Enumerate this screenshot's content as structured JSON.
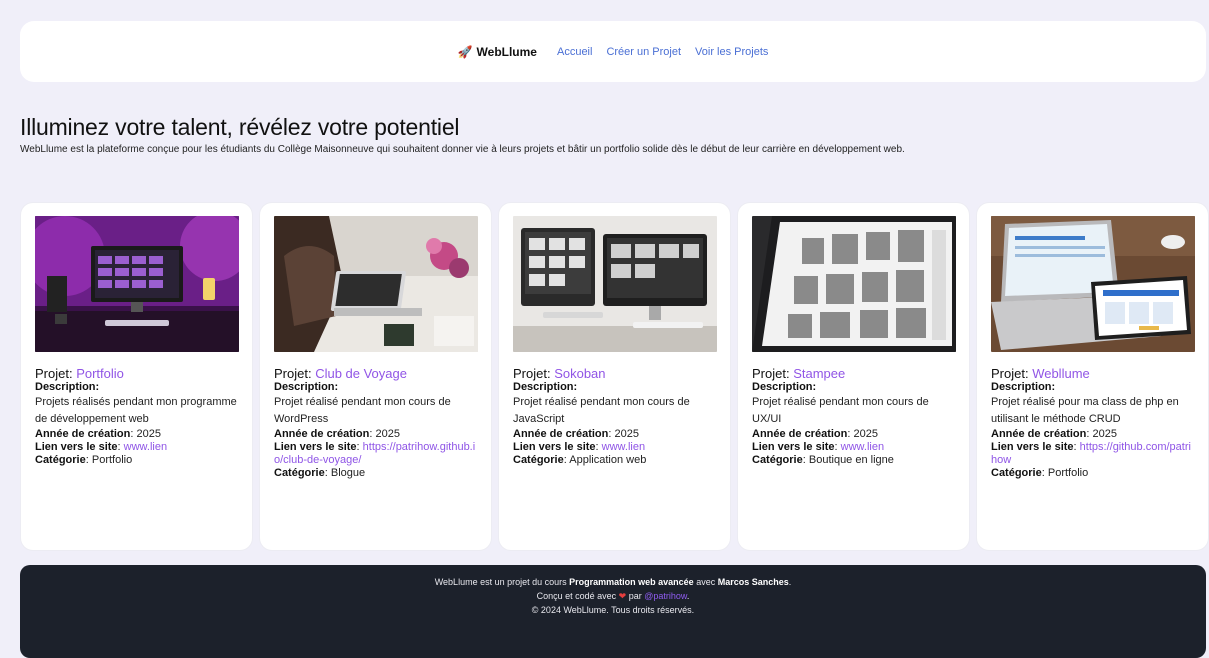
{
  "header": {
    "brand_icon": "rocket-icon",
    "brand": "WebLlume",
    "nav": [
      "Accueil",
      "Créer un Projet",
      "Voir les Projets"
    ],
    "link_color": "#4a6fd4"
  },
  "hero": {
    "title": "Illuminez votre talent, révélez votre potentiel",
    "text": "WebLlume est la plateforme conçue pour les étudiants du Collège Maisonneuve qui souhaitent donner vie à leurs projets et bâtir un portfolio solide dès le début de leur carrière en développement web."
  },
  "labels": {
    "projet": "Projet: ",
    "description": "Description",
    "annee": "Année de création",
    "lien": "Lien vers le site",
    "categorie": "Catégorie"
  },
  "projects": [
    {
      "name": "Portfolio",
      "description": "Projets réalisés pendant mon programme de développement web",
      "annee": "2025",
      "lien": "www.lien",
      "categorie": "Portfolio"
    },
    {
      "name": "Club de Voyage",
      "description": "Projet réalisé pendant mon cours de WordPress",
      "annee": "2025",
      "lien": "https://patrihow.github.io/club-de-voyage/",
      "categorie": "Blogue"
    },
    {
      "name": "Sokoban",
      "description": "Projet réalisé pendant mon cours de JavaScript",
      "annee": "2025",
      "lien": "www.lien",
      "categorie": "Application web"
    },
    {
      "name": "Stampee",
      "description": "Projet réalisé pendant mon cours de UX/UI",
      "annee": "2025",
      "lien": "www.lien",
      "categorie": "Boutique en ligne"
    },
    {
      "name": "Webllume",
      "description": "Projet réalisé pour ma class de php en utilisant le méthode CRUD",
      "annee": "2025",
      "lien": "https://github.com/patrihow",
      "categorie": "Portfolio"
    }
  ],
  "footer": {
    "line1_pre": "WebLlume est un projet du cours ",
    "course": "Programmation web avancée",
    "line1_mid": " avec ",
    "teacher": "Marcos Sanches",
    "line1_end": ".",
    "line2_pre": "Conçu et codé avec ",
    "heart_icon": "heart-icon",
    "line2_mid": " par ",
    "handle": "@patrihow",
    "line2_end": ".",
    "copyright": "© 2024 WebLlume. Tous droits réservés.",
    "handle_color": "#8f5cf0"
  }
}
